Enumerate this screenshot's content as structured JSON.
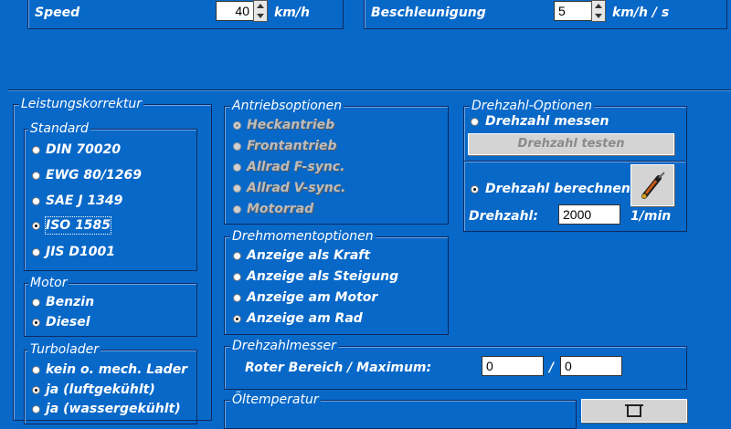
{
  "top": {
    "speed_label": "Speed",
    "speed_value": "40",
    "speed_unit": "km/h",
    "accel_label": "Beschleunigung",
    "accel_value": "5",
    "accel_unit": "km/h / s"
  },
  "leistung": {
    "title": "Leistungskorrektur",
    "standard": {
      "title": "Standard",
      "options": [
        {
          "label": "DIN 70020",
          "selected": false
        },
        {
          "label": "EWG 80/1269",
          "selected": false
        },
        {
          "label": "SAE J 1349",
          "selected": false
        },
        {
          "label": "ISO 1585",
          "selected": true
        },
        {
          "label": "JIS D1001",
          "selected": false
        }
      ]
    },
    "motor": {
      "title": "Motor",
      "options": [
        {
          "label": "Benzin",
          "selected": false
        },
        {
          "label": "Diesel",
          "selected": true
        }
      ]
    },
    "turbo": {
      "title": "Turbolader",
      "options": [
        {
          "label": "kein o. mech. Lader",
          "selected": false
        },
        {
          "label": "ja (luftgekühlt)",
          "selected": true
        },
        {
          "label": "ja (wassergekühlt)",
          "selected": false
        }
      ]
    }
  },
  "antrieb": {
    "title": "Antriebsoptionen",
    "options": [
      {
        "label": "Heckantrieb",
        "selected": true
      },
      {
        "label": "Frontantrieb",
        "selected": false
      },
      {
        "label": "Allrad F-sync.",
        "selected": false
      },
      {
        "label": "Allrad V-sync.",
        "selected": false
      },
      {
        "label": "Motorrad",
        "selected": false
      }
    ]
  },
  "drehmoment": {
    "title": "Drehmomentoptionen",
    "options": [
      {
        "label": "Anzeige als Kraft",
        "selected": false
      },
      {
        "label": "Anzeige als Steigung",
        "selected": false
      },
      {
        "label": "Anzeige am Motor",
        "selected": false
      },
      {
        "label": "Anzeige am Rad",
        "selected": true
      }
    ]
  },
  "drehzahl_opt": {
    "title": "Drehzahl-Optionen",
    "messen_label": "Drehzahl messen",
    "testen_button": "Drehzahl testen",
    "berechnen_label": "Drehzahl berechnen",
    "drehzahl_label": "Drehzahl:",
    "drehzahl_value": "2000",
    "drehzahl_unit": "1/min"
  },
  "drehzahlmesser": {
    "title": "Drehzahlmesser",
    "label": "Roter Bereich / Maximum:",
    "value1": "0",
    "separator": "/",
    "value2": "0"
  },
  "oel": {
    "title": "Öltemperatur"
  }
}
